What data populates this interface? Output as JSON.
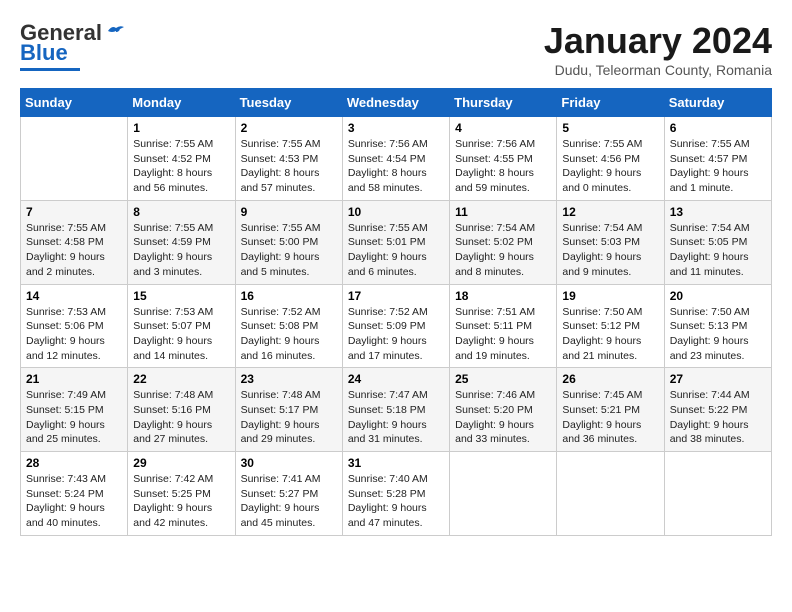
{
  "header": {
    "logo_general": "General",
    "logo_blue": "Blue",
    "month_title": "January 2024",
    "location": "Dudu, Teleorman County, Romania"
  },
  "days_of_week": [
    "Sunday",
    "Monday",
    "Tuesday",
    "Wednesday",
    "Thursday",
    "Friday",
    "Saturday"
  ],
  "weeks": [
    [
      {
        "day": "",
        "sunrise": "",
        "sunset": "",
        "daylight": ""
      },
      {
        "day": "1",
        "sunrise": "Sunrise: 7:55 AM",
        "sunset": "Sunset: 4:52 PM",
        "daylight": "Daylight: 8 hours and 56 minutes."
      },
      {
        "day": "2",
        "sunrise": "Sunrise: 7:55 AM",
        "sunset": "Sunset: 4:53 PM",
        "daylight": "Daylight: 8 hours and 57 minutes."
      },
      {
        "day": "3",
        "sunrise": "Sunrise: 7:56 AM",
        "sunset": "Sunset: 4:54 PM",
        "daylight": "Daylight: 8 hours and 58 minutes."
      },
      {
        "day": "4",
        "sunrise": "Sunrise: 7:56 AM",
        "sunset": "Sunset: 4:55 PM",
        "daylight": "Daylight: 8 hours and 59 minutes."
      },
      {
        "day": "5",
        "sunrise": "Sunrise: 7:55 AM",
        "sunset": "Sunset: 4:56 PM",
        "daylight": "Daylight: 9 hours and 0 minutes."
      },
      {
        "day": "6",
        "sunrise": "Sunrise: 7:55 AM",
        "sunset": "Sunset: 4:57 PM",
        "daylight": "Daylight: 9 hours and 1 minute."
      }
    ],
    [
      {
        "day": "7",
        "sunrise": "Sunrise: 7:55 AM",
        "sunset": "Sunset: 4:58 PM",
        "daylight": "Daylight: 9 hours and 2 minutes."
      },
      {
        "day": "8",
        "sunrise": "Sunrise: 7:55 AM",
        "sunset": "Sunset: 4:59 PM",
        "daylight": "Daylight: 9 hours and 3 minutes."
      },
      {
        "day": "9",
        "sunrise": "Sunrise: 7:55 AM",
        "sunset": "Sunset: 5:00 PM",
        "daylight": "Daylight: 9 hours and 5 minutes."
      },
      {
        "day": "10",
        "sunrise": "Sunrise: 7:55 AM",
        "sunset": "Sunset: 5:01 PM",
        "daylight": "Daylight: 9 hours and 6 minutes."
      },
      {
        "day": "11",
        "sunrise": "Sunrise: 7:54 AM",
        "sunset": "Sunset: 5:02 PM",
        "daylight": "Daylight: 9 hours and 8 minutes."
      },
      {
        "day": "12",
        "sunrise": "Sunrise: 7:54 AM",
        "sunset": "Sunset: 5:03 PM",
        "daylight": "Daylight: 9 hours and 9 minutes."
      },
      {
        "day": "13",
        "sunrise": "Sunrise: 7:54 AM",
        "sunset": "Sunset: 5:05 PM",
        "daylight": "Daylight: 9 hours and 11 minutes."
      }
    ],
    [
      {
        "day": "14",
        "sunrise": "Sunrise: 7:53 AM",
        "sunset": "Sunset: 5:06 PM",
        "daylight": "Daylight: 9 hours and 12 minutes."
      },
      {
        "day": "15",
        "sunrise": "Sunrise: 7:53 AM",
        "sunset": "Sunset: 5:07 PM",
        "daylight": "Daylight: 9 hours and 14 minutes."
      },
      {
        "day": "16",
        "sunrise": "Sunrise: 7:52 AM",
        "sunset": "Sunset: 5:08 PM",
        "daylight": "Daylight: 9 hours and 16 minutes."
      },
      {
        "day": "17",
        "sunrise": "Sunrise: 7:52 AM",
        "sunset": "Sunset: 5:09 PM",
        "daylight": "Daylight: 9 hours and 17 minutes."
      },
      {
        "day": "18",
        "sunrise": "Sunrise: 7:51 AM",
        "sunset": "Sunset: 5:11 PM",
        "daylight": "Daylight: 9 hours and 19 minutes."
      },
      {
        "day": "19",
        "sunrise": "Sunrise: 7:50 AM",
        "sunset": "Sunset: 5:12 PM",
        "daylight": "Daylight: 9 hours and 21 minutes."
      },
      {
        "day": "20",
        "sunrise": "Sunrise: 7:50 AM",
        "sunset": "Sunset: 5:13 PM",
        "daylight": "Daylight: 9 hours and 23 minutes."
      }
    ],
    [
      {
        "day": "21",
        "sunrise": "Sunrise: 7:49 AM",
        "sunset": "Sunset: 5:15 PM",
        "daylight": "Daylight: 9 hours and 25 minutes."
      },
      {
        "day": "22",
        "sunrise": "Sunrise: 7:48 AM",
        "sunset": "Sunset: 5:16 PM",
        "daylight": "Daylight: 9 hours and 27 minutes."
      },
      {
        "day": "23",
        "sunrise": "Sunrise: 7:48 AM",
        "sunset": "Sunset: 5:17 PM",
        "daylight": "Daylight: 9 hours and 29 minutes."
      },
      {
        "day": "24",
        "sunrise": "Sunrise: 7:47 AM",
        "sunset": "Sunset: 5:18 PM",
        "daylight": "Daylight: 9 hours and 31 minutes."
      },
      {
        "day": "25",
        "sunrise": "Sunrise: 7:46 AM",
        "sunset": "Sunset: 5:20 PM",
        "daylight": "Daylight: 9 hours and 33 minutes."
      },
      {
        "day": "26",
        "sunrise": "Sunrise: 7:45 AM",
        "sunset": "Sunset: 5:21 PM",
        "daylight": "Daylight: 9 hours and 36 minutes."
      },
      {
        "day": "27",
        "sunrise": "Sunrise: 7:44 AM",
        "sunset": "Sunset: 5:22 PM",
        "daylight": "Daylight: 9 hours and 38 minutes."
      }
    ],
    [
      {
        "day": "28",
        "sunrise": "Sunrise: 7:43 AM",
        "sunset": "Sunset: 5:24 PM",
        "daylight": "Daylight: 9 hours and 40 minutes."
      },
      {
        "day": "29",
        "sunrise": "Sunrise: 7:42 AM",
        "sunset": "Sunset: 5:25 PM",
        "daylight": "Daylight: 9 hours and 42 minutes."
      },
      {
        "day": "30",
        "sunrise": "Sunrise: 7:41 AM",
        "sunset": "Sunset: 5:27 PM",
        "daylight": "Daylight: 9 hours and 45 minutes."
      },
      {
        "day": "31",
        "sunrise": "Sunrise: 7:40 AM",
        "sunset": "Sunset: 5:28 PM",
        "daylight": "Daylight: 9 hours and 47 minutes."
      },
      {
        "day": "",
        "sunrise": "",
        "sunset": "",
        "daylight": ""
      },
      {
        "day": "",
        "sunrise": "",
        "sunset": "",
        "daylight": ""
      },
      {
        "day": "",
        "sunrise": "",
        "sunset": "",
        "daylight": ""
      }
    ]
  ]
}
